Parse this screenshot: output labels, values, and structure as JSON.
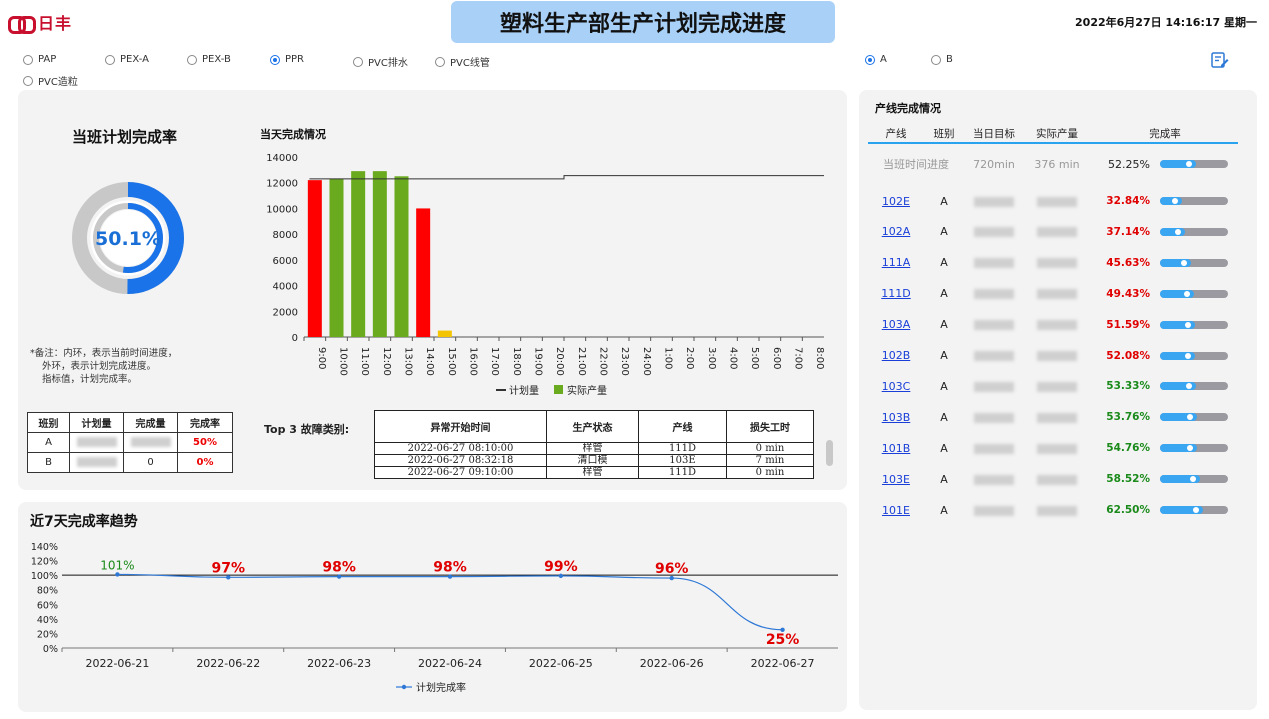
{
  "header": {
    "logo_text": "日丰",
    "title": "塑料生产部生产计划完成进度",
    "datetime": "2022年6月27日 14:16:17 星期一"
  },
  "categories": [
    {
      "label": "PAP",
      "selected": false
    },
    {
      "label": "PEX-A",
      "selected": false
    },
    {
      "label": "PEX-B",
      "selected": false
    },
    {
      "label": "PPR",
      "selected": true
    },
    {
      "label": "PVC排水",
      "selected": false
    },
    {
      "label": "PVC线管",
      "selected": false
    },
    {
      "label": "PVC造粒",
      "selected": false
    }
  ],
  "shifts": [
    {
      "label": "A",
      "selected": true
    },
    {
      "label": "B",
      "selected": false
    }
  ],
  "edit_icon": "edit-icon",
  "shift_rate": {
    "title": "当班计划完成率",
    "value_text": "50.1%",
    "outer_progress": 0.501,
    "inner_progress": 0.5225,
    "note": [
      "*备注：内环，表示当前时间进度，",
      "外环，表示计划完成进度。",
      "指标值，计划完成率。"
    ]
  },
  "shift_table": {
    "headers": [
      "班别",
      "计划量",
      "完成量",
      "完成率"
    ],
    "rows": [
      {
        "shift": "A",
        "plan": "",
        "done": "",
        "rate": "50%"
      },
      {
        "shift": "B",
        "plan": "",
        "done": "0",
        "rate": "0%"
      }
    ]
  },
  "daily_chart_title": "当天完成情况",
  "top3": {
    "label": "Top 3 故障类别:",
    "headers": [
      "异常开始时间",
      "生产状态",
      "产线",
      "损失工时"
    ],
    "rows": [
      [
        "2022-06-27 08:10:00",
        "样管",
        "111D",
        "0 min"
      ],
      [
        "2022-06-27 08:32:18",
        "清口模",
        "103E",
        "7 min"
      ],
      [
        "2022-06-27 09:10:00",
        "样管",
        "111D",
        "0 min"
      ]
    ]
  },
  "trend_title": "近7天完成率趋势",
  "lines_panel": {
    "title": "产线完成情况",
    "headers": [
      "产线",
      "班别",
      "当日目标",
      "实际产量",
      "完成率"
    ],
    "progress_row": {
      "label": "当班时间进度",
      "target": "720min",
      "actual": "376 min",
      "rate": "52.25%",
      "value": 0.5225
    },
    "rows": [
      {
        "line": "102E",
        "shift": "A",
        "rate": "32.84%",
        "value": 0.3284,
        "color": "#e00000"
      },
      {
        "line": "102A",
        "shift": "A",
        "rate": "37.14%",
        "value": 0.3714,
        "color": "#e00000"
      },
      {
        "line": "111A",
        "shift": "A",
        "rate": "45.63%",
        "value": 0.4563,
        "color": "#e00000"
      },
      {
        "line": "111D",
        "shift": "A",
        "rate": "49.43%",
        "value": 0.4943,
        "color": "#e00000"
      },
      {
        "line": "103A",
        "shift": "A",
        "rate": "51.59%",
        "value": 0.5159,
        "color": "#e00000"
      },
      {
        "line": "102B",
        "shift": "A",
        "rate": "52.08%",
        "value": 0.5208,
        "color": "#e00000"
      },
      {
        "line": "103C",
        "shift": "A",
        "rate": "53.33%",
        "value": 0.5333,
        "color": "#1a8a1a"
      },
      {
        "line": "103B",
        "shift": "A",
        "rate": "53.76%",
        "value": 0.5376,
        "color": "#1a8a1a"
      },
      {
        "line": "101B",
        "shift": "A",
        "rate": "54.76%",
        "value": 0.5476,
        "color": "#1a8a1a"
      },
      {
        "line": "103E",
        "shift": "A",
        "rate": "58.52%",
        "value": 0.5852,
        "color": "#1a8a1a"
      },
      {
        "line": "101E",
        "shift": "A",
        "rate": "62.50%",
        "value": 0.625,
        "color": "#1a8a1a"
      }
    ]
  },
  "chart_data": [
    {
      "type": "bar",
      "title": "当天完成情况",
      "categories": [
        "9:00",
        "10:00",
        "11:00",
        "12:00",
        "13:00",
        "14:00",
        "15:00",
        "16:00",
        "17:00",
        "18:00",
        "19:00",
        "20:00",
        "21:00",
        "22:00",
        "23:00",
        "24:00",
        "1:00",
        "2:00",
        "3:00",
        "4:00",
        "5:00",
        "6:00",
        "7:00",
        "8:00"
      ],
      "ylim": [
        0,
        14000
      ],
      "yticks": [
        0,
        2000,
        4000,
        6000,
        8000,
        10000,
        12000,
        14000
      ],
      "series": [
        {
          "name": "实际产量",
          "values": [
            12200,
            12300,
            12900,
            12900,
            12500,
            10000,
            500,
            null,
            null,
            null,
            null,
            null,
            null,
            null,
            null,
            null,
            null,
            null,
            null,
            null,
            null,
            null,
            null,
            null
          ],
          "colors": [
            "#ff0000",
            "#6aaa1e",
            "#6aaa1e",
            "#6aaa1e",
            "#6aaa1e",
            "#ff0000",
            "#f5c400"
          ]
        },
        {
          "name": "计划量",
          "values": [
            12300,
            12300,
            12300,
            12300,
            12300,
            12300,
            12300,
            12300,
            12300,
            12300,
            12300,
            12300,
            12550,
            12550,
            12550,
            12550,
            12550,
            12550,
            12550,
            12550,
            12550,
            12550,
            12550,
            12550
          ],
          "color": "#333333"
        }
      ],
      "legend": [
        {
          "name": "计划量",
          "color": "#333333"
        },
        {
          "name": "实际产量",
          "color": "#6aaa1e"
        }
      ],
      "legend_position": "bottom"
    },
    {
      "type": "line",
      "title": "近7天完成率趋势",
      "x": [
        "2022-06-21",
        "2022-06-22",
        "2022-06-23",
        "2022-06-24",
        "2022-06-25",
        "2022-06-26",
        "2022-06-27"
      ],
      "values": [
        101,
        97,
        98,
        98,
        99,
        96,
        25
      ],
      "labels": [
        "101%",
        "97%",
        "98%",
        "98%",
        "99%",
        "96%",
        "25%"
      ],
      "label_colors": [
        "#1a8a1a",
        "#e00000",
        "#e00000",
        "#e00000",
        "#e00000",
        "#e00000",
        "#e00000"
      ],
      "ylim": [
        0,
        140
      ],
      "yticks": [
        "0%",
        "20%",
        "40%",
        "60%",
        "80%",
        "100%",
        "120%",
        "140%"
      ],
      "reference_line": 100,
      "series_name": "计划完成率",
      "color": "#2e78d6",
      "legend_position": "bottom"
    }
  ]
}
